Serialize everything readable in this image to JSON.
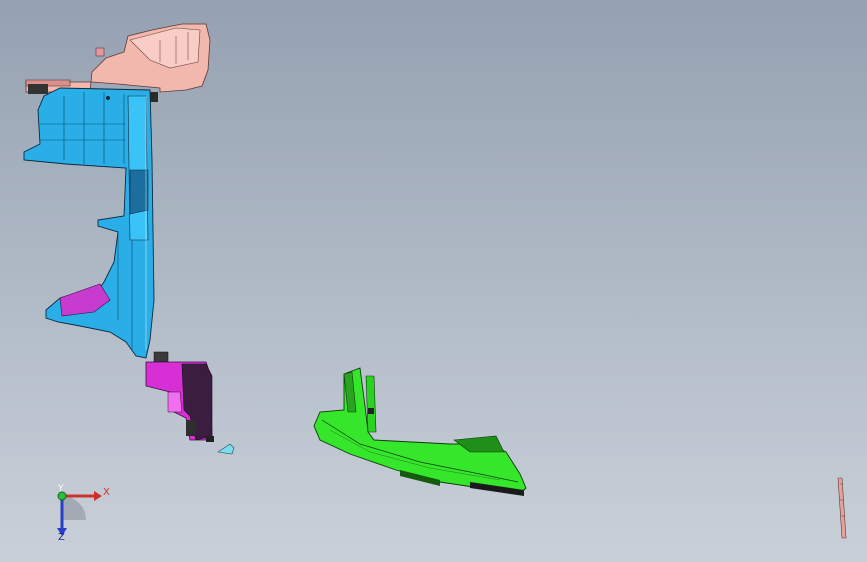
{
  "viewport": {
    "background_top": "#95a1b1",
    "background_bottom": "#c9d0d9"
  },
  "triad": {
    "x_label": "X",
    "y_label": "Y",
    "z_label": "Z",
    "x_color": "#d0302b",
    "y_color": "#2bbf3a",
    "z_color": "#2a3cc9"
  },
  "parts": [
    {
      "name": "top-bracket-part",
      "color": "#f2b7ad"
    },
    {
      "name": "blue-panel-part",
      "color": "#29aee8"
    },
    {
      "name": "magenta-bracket-part",
      "color": "#d72fd6"
    },
    {
      "name": "green-bumper-part",
      "color": "#35e62b"
    },
    {
      "name": "small-clip-part",
      "color": "#7fdcef"
    },
    {
      "name": "thin-strip-part",
      "color": "#e7a39b"
    }
  ]
}
